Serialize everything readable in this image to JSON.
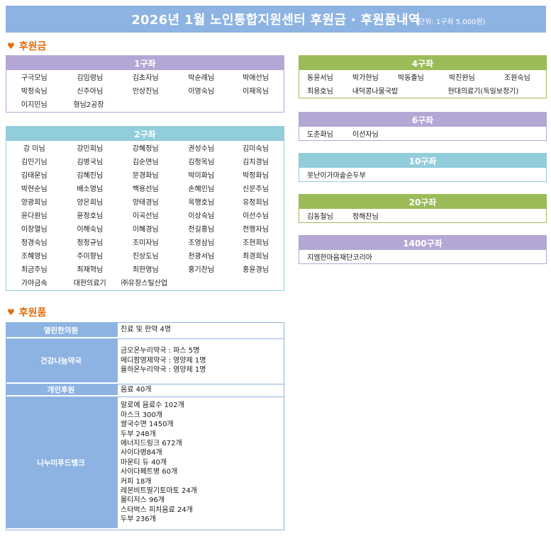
{
  "header": {
    "title": "2026년 1월 노인통합지원센터 후원금 · 후원품내역",
    "unit": "(단위: 1구좌 5,000원)"
  },
  "icons": {
    "section_marker": "heart-icon"
  },
  "colors": {
    "banner": "#8db3e2",
    "section_title": "#e36c09",
    "purple": "#b4a7d6",
    "teal": "#92cddc",
    "green": "#9bbb59",
    "gift_blue": "#8db3e2"
  },
  "sections": {
    "donations": "후원금",
    "goods": "후원품"
  },
  "groups": {
    "g1": {
      "label": "1구좌",
      "rows": [
        [
          "구극모님",
          "김임령님",
          "김초자님",
          "박순례님",
          "박애선님"
        ],
        [
          "박정숙님",
          "신주아님",
          "안상진님",
          "이영숙님",
          "이재옥님"
        ],
        [
          "이지민님",
          "형님2공장"
        ]
      ]
    },
    "g2": {
      "label": "2구좌",
      "rows": [
        [
          "강  미님",
          "강민희님",
          "강혜정님",
          "권성수님",
          "김미숙님"
        ],
        [
          "김민기님",
          "김병국님",
          "김순연님",
          "김정옥님",
          "김치경님"
        ],
        [
          "김태운님",
          "김혜진님",
          "문경화님",
          "박미화님",
          "박정화님"
        ],
        [
          "박현순님",
          "배소영님",
          "백용선님",
          "손혜인님",
          "신문주님"
        ],
        [
          "양광희님",
          "양은희님",
          "양태경님",
          "옥행호님",
          "유정희님"
        ],
        [
          "윤다원님",
          "윤정호님",
          "이곡선님",
          "이상숙님",
          "이선수님"
        ],
        [
          "이창열님",
          "이해숙님",
          "이혜경님",
          "전길홍님",
          "전행자님"
        ],
        [
          "정경숙님",
          "정정규님",
          "조미자님",
          "조영삼님",
          "조현희님"
        ],
        [
          "조혜영님",
          "주미향님",
          "진상도님",
          "천광서님",
          "최경희님"
        ],
        [
          "최금주님",
          "최재혁님",
          "최한영님",
          "홍기찬님",
          "홍윤경님"
        ],
        [
          "가야금속",
          "대한의료기",
          "㈜유창스틸산업"
        ]
      ]
    },
    "g4": {
      "label": "4구좌",
      "rows": [
        [
          "동윤서님",
          "박가현님",
          "박동출님",
          "박진완님",
          "조원숙님"
        ],
        [
          "최용호님",
          "내덕콩나물국밥",
          "현대의료기(독일보청기)"
        ]
      ]
    },
    "g6": {
      "label": "6구좌",
      "rows": [
        [
          "도춘화님",
          "이선자님"
        ]
      ]
    },
    "g10": {
      "label": "10구좌",
      "rows": [
        [
          "못난이가마솥순두부"
        ]
      ]
    },
    "g20": {
      "label": "20구좌",
      "rows": [
        [
          "김동철님",
          "정해찬님"
        ]
      ]
    },
    "g1400": {
      "label": "1400구좌",
      "rows": [
        [
          "지엠한마음재단코리아"
        ]
      ]
    }
  },
  "gifts": [
    {
      "category": "열린한의원",
      "items": [
        "진료 및 한약 4명"
      ]
    },
    {
      "category": "건강나눔약국",
      "items": [
        "금오온누리약국 : 파스 5명",
        "메디팜영제약국 : 영양제 1명",
        "율하온누리약국 : 영양제 1명"
      ]
    },
    {
      "category": "개인후원",
      "items": [
        "음료 40개"
      ]
    },
    {
      "category": "나누미푸드뱅크",
      "items": [
        "알로에 음료수 102개",
        "마스크 300개",
        "쌀국수면 1450개",
        "두부 248개",
        "에너지드링크 672개",
        "사이다병84개",
        "마운티 듀 40개",
        "사이다페트병 60개",
        "커피 18개",
        "레몬비트딸기토마토 24개",
        "몰티저스 96개",
        "스타벅스 피치음료 24개",
        "두부 236개"
      ]
    }
  ]
}
